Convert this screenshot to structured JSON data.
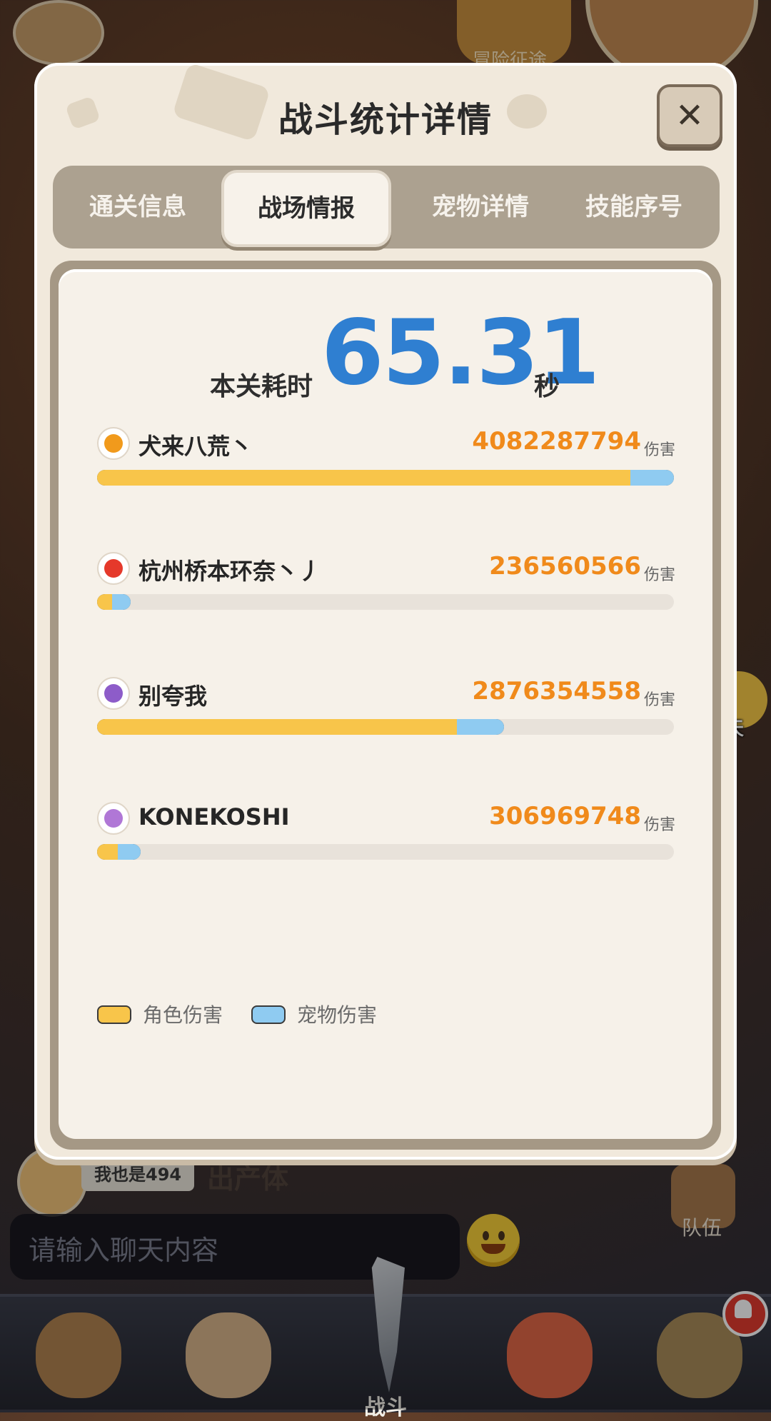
{
  "background": {
    "top_banner": "冒险征途",
    "chat_placeholder": "请输入聊天内容",
    "mini_user_name": "我也是494",
    "mini_tag": "出产体",
    "team_label": "队伍",
    "chat_bubble_label": "聊天",
    "nav_items": [
      {
        "label": "",
        "icon": "character-icon"
      },
      {
        "label": "",
        "icon": "character-icon"
      },
      {
        "label": "战斗",
        "icon": "sword-icon"
      },
      {
        "label": "",
        "icon": "pet-icon"
      },
      {
        "label": "",
        "icon": "character-icon"
      }
    ]
  },
  "modal": {
    "title": "战斗统计详情",
    "close_icon": "close-icon",
    "tabs": [
      {
        "label": "通关信息",
        "active": false
      },
      {
        "label": "战场情报",
        "active": true
      },
      {
        "label": "宠物详情",
        "active": false
      },
      {
        "label": "技能序号",
        "active": false
      }
    ],
    "time": {
      "label": "本关耗时",
      "value": "65.31",
      "unit": "秒"
    },
    "damage_unit": "伤害",
    "players": [
      {
        "name": "犬来八荒丶",
        "damage": "4082287794",
        "icon": "flame-claw-icon",
        "icon_color": "#f19a1c",
        "char_fraction": 0.925,
        "pet_fraction": 0.075,
        "bar_fraction": 1.0
      },
      {
        "name": "杭州桥本环奈丶丿",
        "damage": "236560566",
        "icon": "red-swirl-icon",
        "icon_color": "#e5392b",
        "char_fraction": 0.45,
        "pet_fraction": 0.55,
        "bar_fraction": 0.058
      },
      {
        "name": "别夸我",
        "damage": "2876354558",
        "icon": "purple-swirl-icon",
        "icon_color": "#8d5cc9",
        "char_fraction": 0.885,
        "pet_fraction": 0.115,
        "bar_fraction": 0.705
      },
      {
        "name": "KONEKOSHI",
        "damage": "306969748",
        "icon": "purple-orb-icon",
        "icon_color": "#b077d6",
        "char_fraction": 0.47,
        "pet_fraction": 0.53,
        "bar_fraction": 0.075
      }
    ],
    "legend": [
      {
        "label": "角色伤害",
        "color": "#f8c54a"
      },
      {
        "label": "宠物伤害",
        "color": "#8fcbf1"
      }
    ]
  }
}
